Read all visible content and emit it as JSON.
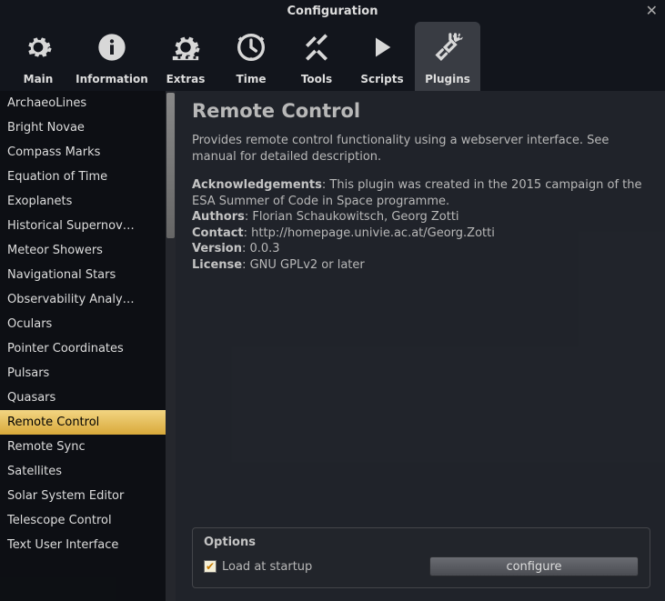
{
  "window": {
    "title": "Configuration"
  },
  "tabs": [
    {
      "label": "Main"
    },
    {
      "label": "Information"
    },
    {
      "label": "Extras"
    },
    {
      "label": "Time"
    },
    {
      "label": "Tools"
    },
    {
      "label": "Scripts"
    },
    {
      "label": "Plugins"
    }
  ],
  "plugins": [
    "ArchaeoLines",
    "Bright Novae",
    "Compass Marks",
    "Equation of Time",
    "Exoplanets",
    "Historical Supernovae",
    "Meteor Showers",
    "Navigational Stars",
    "Observability Analysis",
    "Oculars",
    "Pointer Coordinates",
    "Pulsars",
    "Quasars",
    "Remote Control",
    "Remote Sync",
    "Satellites",
    "Solar System Editor",
    "Telescope Control",
    "Text User Interface"
  ],
  "selected_plugin_index": 13,
  "detail": {
    "title": "Remote Control",
    "description": "Provides remote control functionality using a webserver interface. See manual for detailed description.",
    "ack_label": "Acknowledgements",
    "ack_text": ": This plugin was created in the 2015 campaign of the ESA Summer of Code in Space programme.",
    "authors_label": "Authors",
    "authors_text": ": Florian Schaukowitsch, Georg Zotti",
    "contact_label": "Contact",
    "contact_text": ": http://homepage.univie.ac.at/Georg.Zotti",
    "version_label": "Version",
    "version_text": ": 0.0.3",
    "license_label": "License",
    "license_text": ": GNU GPLv2 or later"
  },
  "options": {
    "title": "Options",
    "load_label": "Load at startup",
    "load_checked": true,
    "configure_label": "configure"
  }
}
